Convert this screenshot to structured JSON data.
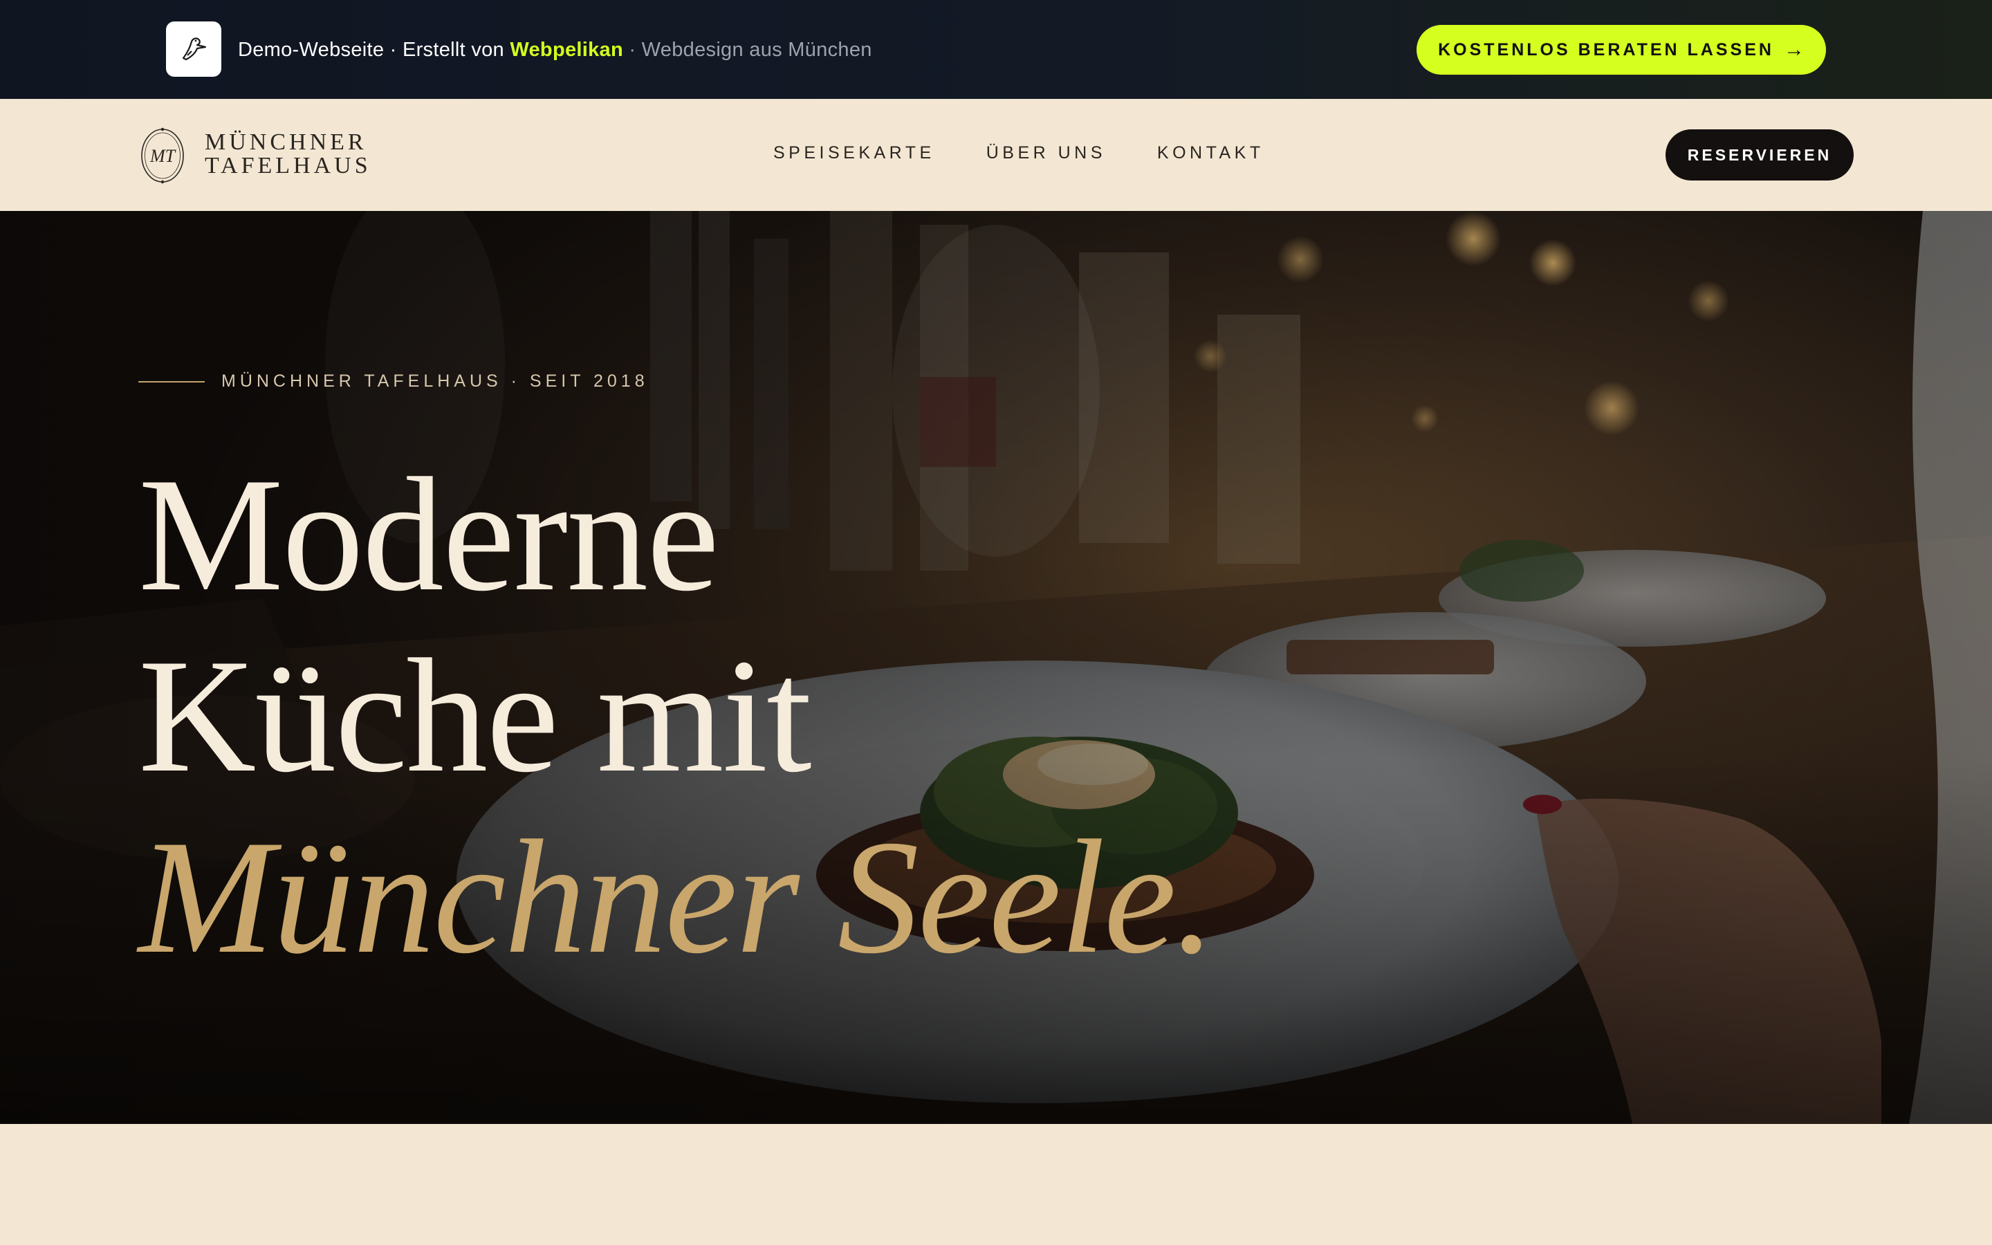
{
  "promo": {
    "logo_icon": "pelican-icon",
    "text_demo": "Demo-Webseite · Erstellt von ",
    "text_brand": "Webpelikan",
    "text_suffix": " · Webdesign aus München",
    "cta_label": "KOSTENLOS BERATEN LASSEN",
    "cta_arrow": "→",
    "accent_color": "#d5ff1f"
  },
  "nav": {
    "logo_monogram": "MT",
    "brand_line1": "MÜNCHNER",
    "brand_line2": "TAFELHAUS",
    "links": [
      "SPEISEKARTE",
      "ÜBER UNS",
      "KONTAKT"
    ],
    "reserve_label": "RESERVIEREN"
  },
  "hero": {
    "eyebrow": "MÜNCHNER TAFELHAUS · SEIT 2018",
    "title_line1": "Moderne",
    "title_line2": "Küche mit",
    "title_line3": "Münchner Seele.",
    "accent_color": "#c9a66b",
    "background": "restaurant table with plated dish (photo)"
  }
}
